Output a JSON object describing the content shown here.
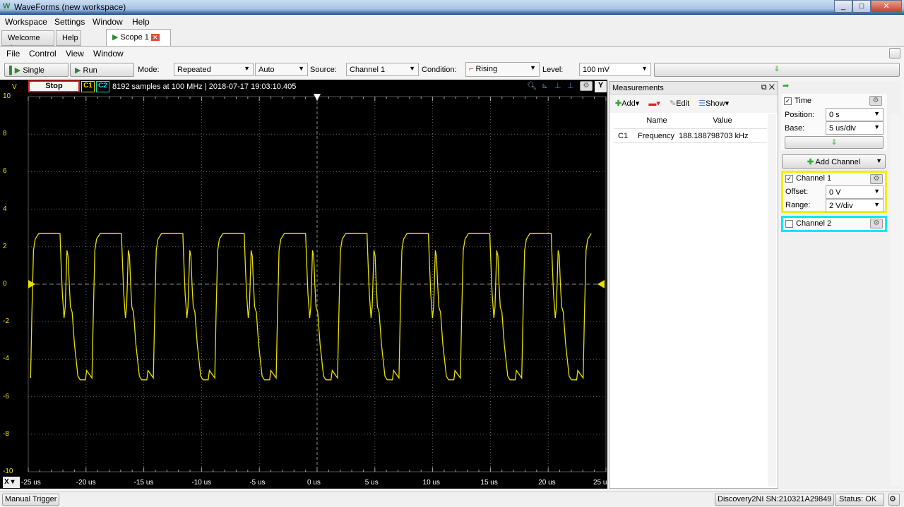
{
  "window": {
    "title": "WaveForms  (new workspace)",
    "controls": [
      "_",
      "□",
      "✕"
    ]
  },
  "menubar": [
    "Workspace",
    "Settings",
    "Window",
    "Help"
  ],
  "tabs": [
    {
      "label": "Welcome"
    },
    {
      "label": "Help"
    },
    {
      "label": "Scope 1"
    }
  ],
  "scope_menu": [
    "File",
    "Control",
    "View",
    "Window"
  ],
  "toolbar": {
    "single": "Single",
    "run": "Run",
    "mode_label": "Mode:",
    "mode": "Repeated",
    "auto": "Auto",
    "source_label": "Source:",
    "source": "Channel 1",
    "condition_label": "Condition:",
    "condition": "Rising",
    "level_label": "Level:",
    "level": "100 mV"
  },
  "plot_header": {
    "v": "V",
    "stop": "Stop",
    "c1": "C1",
    "c2": "C2",
    "info": "8192 samples at 100 MHz | 2018-07-17 19:03:10.405",
    "y_btn": "Y",
    "x_btn": "X"
  },
  "colors": {
    "channel1": "#e8e000",
    "channel2": "#00e0f0",
    "stop_border": "#e02020"
  },
  "chart_data": {
    "type": "line",
    "y_ticks": [
      "10",
      "8",
      "6",
      "4",
      "2",
      "0",
      "-2",
      "-4",
      "-6",
      "-8",
      "-10"
    ],
    "x_ticks": [
      "-25 us",
      "-20 us",
      "-15 us",
      "-10 us",
      "-5 us",
      "0 us",
      "5 us",
      "10 us",
      "15 us",
      "20 us",
      "25 us"
    ],
    "xlim": [
      -25,
      25
    ],
    "ylim": [
      -10,
      10
    ],
    "grid": true,
    "series": [
      {
        "name": "C1",
        "frequency_khz": 188.188798703,
        "first_rising_us": -24.6,
        "period_shape": [
          [
            0,
            -5.0
          ],
          [
            0.12,
            -1.5
          ],
          [
            0.25,
            1.8
          ],
          [
            0.4,
            2.4
          ],
          [
            0.7,
            2.7
          ],
          [
            2.55,
            2.7
          ],
          [
            2.65,
            1.0
          ],
          [
            2.75,
            -0.5
          ],
          [
            2.9,
            -1.8
          ],
          [
            3.0,
            -1.2
          ],
          [
            3.15,
            1.8
          ],
          [
            3.25,
            1.5
          ],
          [
            3.35,
            0
          ],
          [
            3.45,
            -1.2
          ],
          [
            3.6,
            -1.5
          ],
          [
            3.8,
            -3.2
          ],
          [
            4.1,
            -4.9
          ],
          [
            4.3,
            -5.1
          ],
          [
            4.75,
            -5.1
          ],
          [
            4.85,
            -4.6
          ],
          [
            5.314,
            -5.0
          ]
        ]
      }
    ]
  },
  "measurements": {
    "title": "Measurements",
    "add": "Add",
    "edit": "Edit",
    "show": "Show",
    "columns": [
      "Name",
      "Value"
    ],
    "rows": [
      {
        "ch": "C1",
        "name": "Frequency",
        "value": "188.188798703 kHz"
      }
    ]
  },
  "side": {
    "time": "Time",
    "position_label": "Position:",
    "position": "0 s",
    "base_label": "Base:",
    "base": "5 us/div",
    "add_channel": "Add Channel",
    "ch1": "Channel 1",
    "offset_label": "Offset:",
    "offset": "0 V",
    "range_label": "Range:",
    "range": "2 V/div",
    "ch2": "Channel 2"
  },
  "status": {
    "manual_trigger": "Manual Trigger",
    "device": "Discovery2NI SN:210321A29849",
    "state": "Status: OK"
  }
}
